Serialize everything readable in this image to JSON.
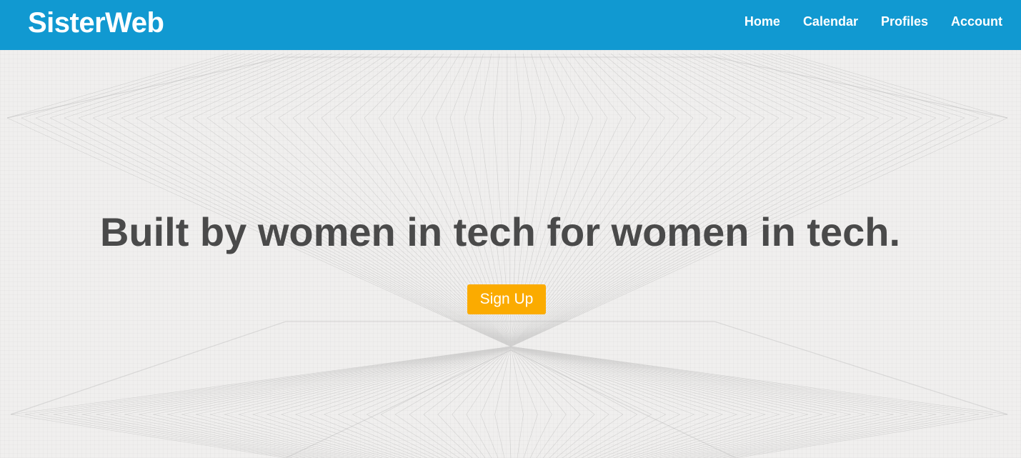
{
  "navbar": {
    "brand": "SisterWeb",
    "links": [
      {
        "label": "Home"
      },
      {
        "label": "Calendar"
      },
      {
        "label": "Profiles"
      },
      {
        "label": "Account"
      }
    ],
    "color": "#1199d1"
  },
  "hero": {
    "title": "Built by women in tech for women in tech.",
    "signup_label": "Sign Up",
    "accent_color": "#fbab00"
  }
}
